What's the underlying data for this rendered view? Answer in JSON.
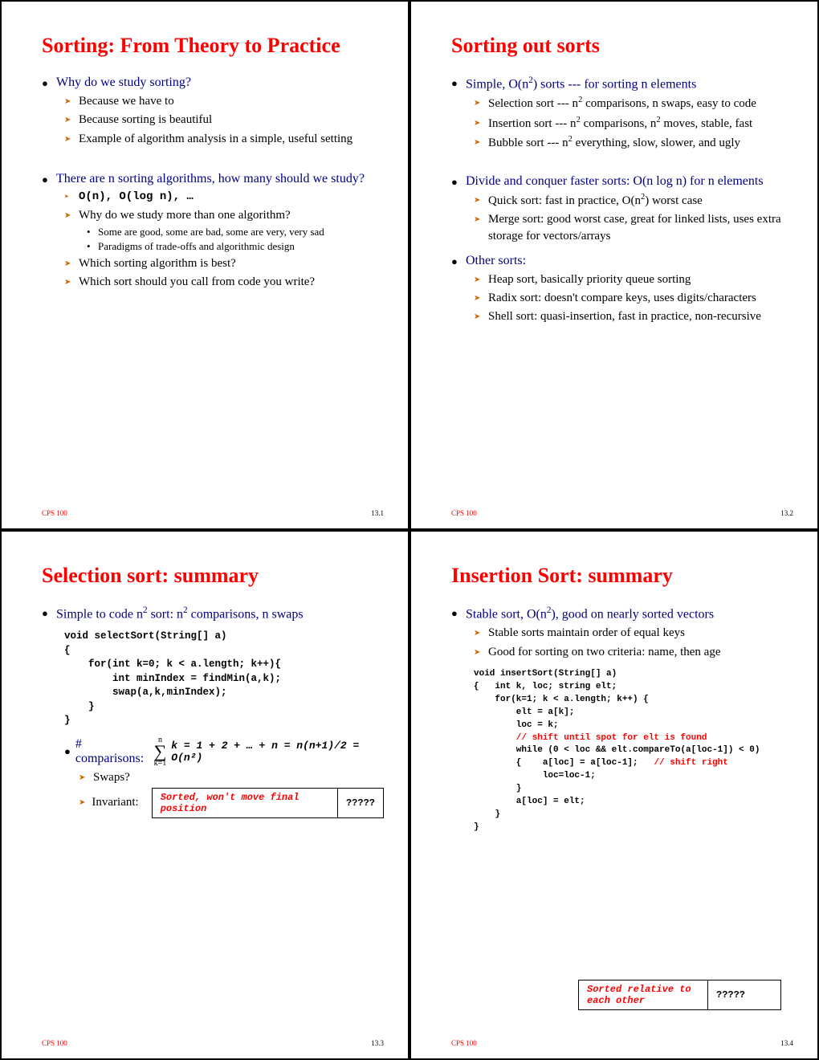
{
  "course": "CPS 100",
  "slides": [
    {
      "title": "Sorting: From Theory to Practice",
      "page": "13.1",
      "h1": "Why do we study sorting?",
      "h1_items": [
        "Because we have to",
        "Because sorting is beautiful",
        "Example of algorithm analysis in a simple, useful setting"
      ],
      "h2": "There are n sorting algorithms, how many should we study?",
      "h2_code": "O(n), O(log n), …",
      "h2_q1": "Why do we study more than one algorithm?",
      "h2_q1_subs": [
        "Some are good, some are bad, some are very, very sad",
        "Paradigms of trade-offs and algorithmic design"
      ],
      "h2_q2": "Which sorting algorithm is best?",
      "h2_q3": "Which sort should you call from code you write?"
    },
    {
      "title": "Sorting out sorts",
      "page": "13.2",
      "b1_prefix": "Simple, O(n",
      "b1_suffix": ") sorts --- for sorting n elements",
      "b1_items_html": [
        "Selection sort --- n<sup>2</sup> comparisons, n swaps, easy to code",
        "Insertion sort --- n<sup>2</sup> comparisons, n<sup>2</sup> moves, stable, fast",
        "Bubble sort --- n<sup>2</sup> everything, slow, slower, and ugly"
      ],
      "b2": "Divide and conquer faster sorts: O(n log n) for n elements",
      "b2_items_html": [
        "Quick sort: fast in practice, O(n<sup>2</sup>) worst case",
        "Merge sort: good worst case, great for linked lists, uses extra storage for vectors/arrays"
      ],
      "b3": "Other sorts:",
      "b3_items": [
        "Heap sort, basically priority queue sorting",
        "Radix sort: doesn't compare keys, uses digits/characters",
        "Shell sort: quasi-insertion, fast in practice, non-recursive"
      ]
    },
    {
      "title": "Selection sort: summary",
      "page": "13.3",
      "b1_prefix": "Simple to code n",
      "b1_mid": " sort: n",
      "b1_suffix": " comparisons, n swaps",
      "code": "void selectSort(String[] a)\n{\n    for(int k=0; k < a.length; k++){\n        int minIndex = findMin(a,k);\n        swap(a,k,minIndex);\n    }\n}",
      "comp_label": "# comparisons:",
      "sigma_top": "n",
      "sigma_bot": "k=1",
      "comp_expr": "k = 1 + 2 + … + n = n(n+1)/2 = O(n²)",
      "swaps": "Swaps?",
      "invariant_label": "Invariant:",
      "inv_left": "Sorted, won't move final position",
      "inv_right": "?????"
    },
    {
      "title": "Insertion Sort: summary",
      "page": "13.4",
      "b1_prefix": "Stable sort, O(n",
      "b1_suffix": "), good on nearly sorted vectors",
      "b1_items": [
        "Stable sorts maintain order of equal keys",
        "Good for sorting on two criteria: name, then age"
      ],
      "code_l1": "void insertSort(String[] a)",
      "code_l2": "{   int k, loc; string elt;",
      "code_l3": "    for(k=1; k < a.length; k++) {",
      "code_l4": "        elt = a[k];",
      "code_l5": "        loc = k;",
      "code_l6": "        // shift until spot for elt is found",
      "code_l7": "        while (0 < loc && elt.compareTo(a[loc-1]) < 0)",
      "code_l8a": "        {    a[loc] = a[loc-1];   ",
      "code_l8b": "// shift right",
      "code_l9": "             loc=loc-1;",
      "code_l10": "        }",
      "code_l11": "        a[loc] = elt;",
      "code_l12": "    }",
      "code_l13": "}",
      "inv_left": "Sorted relative to each other",
      "inv_right": "?????"
    }
  ]
}
